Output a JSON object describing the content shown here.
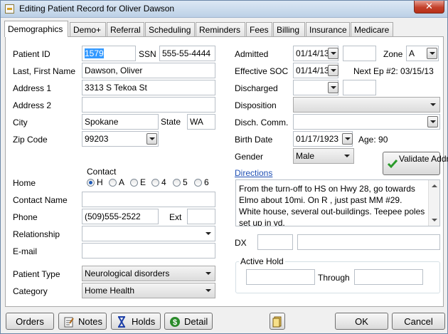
{
  "window": {
    "title": "Editing Patient Record for Oliver Dawson",
    "close": "✕"
  },
  "tabs": [
    "Demographics",
    "Demo+",
    "Referral",
    "Scheduling",
    "Reminders",
    "Fees",
    "Billing",
    "Insurance",
    "Medicare"
  ],
  "left": {
    "patient_id_label": "Patient ID",
    "patient_id": "1579",
    "ssn_label": "SSN",
    "ssn": "555-55-4444",
    "name_label": "Last, First Name",
    "name": "Dawson, Oliver",
    "address1_label": "Address 1",
    "address1": "3313 S Tekoa St",
    "address2_label": "Address 2",
    "address2": "",
    "city_label": "City",
    "city": "Spokane",
    "state_label": "State",
    "state": "WA",
    "zip_label": "Zip Code",
    "zip": "99203",
    "contact_label": "Contact",
    "home_label": "Home",
    "radios": [
      "H",
      "A",
      "E",
      "4",
      "5",
      "6"
    ],
    "contact_name_label": "Contact Name",
    "contact_name": "",
    "phone_label": "Phone",
    "phone": "(509)555-2522",
    "ext_label": "Ext",
    "ext": "",
    "relationship_label": "Relationship",
    "relationship": "",
    "email_label": "E-mail",
    "email": "",
    "patient_type_label": "Patient Type",
    "patient_type": "Neurological disorders",
    "category_label": "Category",
    "category": "Home Health"
  },
  "right": {
    "admitted_label": "Admitted",
    "admitted": "01/14/13",
    "zone_label": "Zone",
    "zone": "A",
    "soc_label": "Effective SOC",
    "soc": "01/14/13",
    "next_ep": "Next Ep #2: 03/15/13",
    "discharged_label": "Discharged",
    "disposition_label": "Disposition",
    "disch_comm_label": "Disch. Comm.",
    "birth_label": "Birth Date",
    "birth": "01/17/1923",
    "age": "Age: 90",
    "gender_label": "Gender",
    "gender": "Male",
    "validate": "Validate Address",
    "directions_label": "Directions",
    "directions": "From the turn-off to HS on Hwy 28, go towards Elmo about 10mi. On R , just past MM #29. White house, several out-buildings. Teepee poles set up in yd.",
    "dx_label": "DX",
    "active_hold_label": "Active Hold",
    "through_label": "Through"
  },
  "footer": {
    "orders": "Orders",
    "notes": "Notes",
    "holds": "Holds",
    "detail": "Detail",
    "ok": "OK",
    "cancel": "Cancel"
  },
  "colors": {
    "selection": "#3399ff",
    "link": "#1f4fb4",
    "close": "#c3402a",
    "check": "#2a9a2a"
  }
}
